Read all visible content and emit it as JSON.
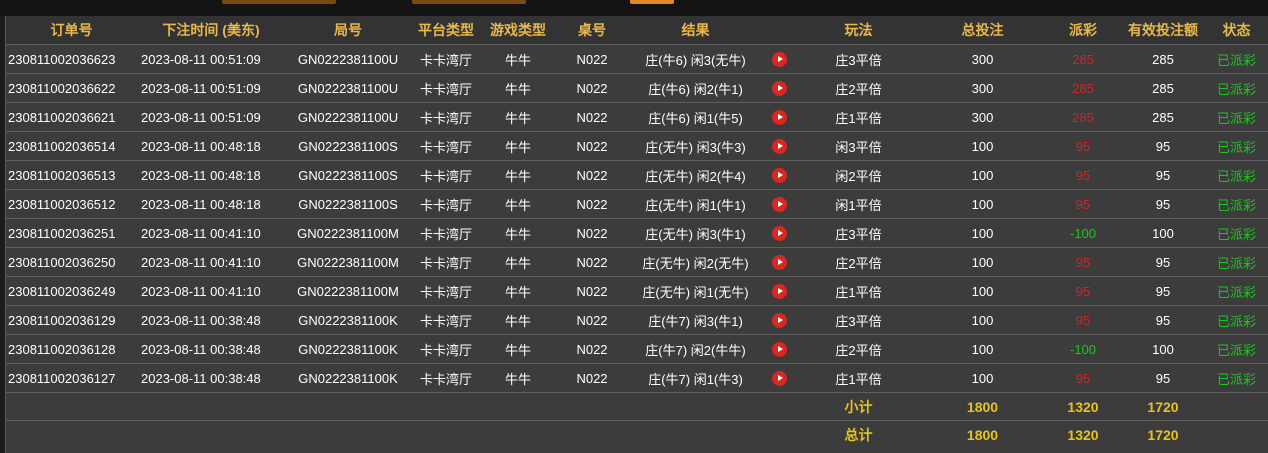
{
  "headers": [
    "订单号",
    "下注时间 (美东)",
    "局号",
    "平台类型",
    "游戏类型",
    "桌号",
    "结果",
    "",
    "玩法",
    "总投注",
    "派彩",
    "有效投注额",
    "状态"
  ],
  "rows": [
    {
      "order": "230811002036623",
      "time": "2023-08-11 00:51:09",
      "round": "GN0222381100U",
      "platform": "卡卡湾厅",
      "game": "牛牛",
      "table": "N022",
      "result": "庄(牛6) 闲3(无牛)",
      "play": "庄3平倍",
      "bet": "300",
      "payout": "285",
      "payout_color": "red",
      "valid": "285",
      "status": "已派彩"
    },
    {
      "order": "230811002036622",
      "time": "2023-08-11 00:51:09",
      "round": "GN0222381100U",
      "platform": "卡卡湾厅",
      "game": "牛牛",
      "table": "N022",
      "result": "庄(牛6) 闲2(牛1)",
      "play": "庄2平倍",
      "bet": "300",
      "payout": "285",
      "payout_color": "red",
      "valid": "285",
      "status": "已派彩"
    },
    {
      "order": "230811002036621",
      "time": "2023-08-11 00:51:09",
      "round": "GN0222381100U",
      "platform": "卡卡湾厅",
      "game": "牛牛",
      "table": "N022",
      "result": "庄(牛6) 闲1(牛5)",
      "play": "庄1平倍",
      "bet": "300",
      "payout": "285",
      "payout_color": "red",
      "valid": "285",
      "status": "已派彩"
    },
    {
      "order": "230811002036514",
      "time": "2023-08-11 00:48:18",
      "round": "GN0222381100S",
      "platform": "卡卡湾厅",
      "game": "牛牛",
      "table": "N022",
      "result": "庄(无牛) 闲3(牛3)",
      "play": "闲3平倍",
      "bet": "100",
      "payout": "95",
      "payout_color": "red",
      "valid": "95",
      "status": "已派彩"
    },
    {
      "order": "230811002036513",
      "time": "2023-08-11 00:48:18",
      "round": "GN0222381100S",
      "platform": "卡卡湾厅",
      "game": "牛牛",
      "table": "N022",
      "result": "庄(无牛) 闲2(牛4)",
      "play": "闲2平倍",
      "bet": "100",
      "payout": "95",
      "payout_color": "red",
      "valid": "95",
      "status": "已派彩"
    },
    {
      "order": "230811002036512",
      "time": "2023-08-11 00:48:18",
      "round": "GN0222381100S",
      "platform": "卡卡湾厅",
      "game": "牛牛",
      "table": "N022",
      "result": "庄(无牛) 闲1(牛1)",
      "play": "闲1平倍",
      "bet": "100",
      "payout": "95",
      "payout_color": "red",
      "valid": "95",
      "status": "已派彩"
    },
    {
      "order": "230811002036251",
      "time": "2023-08-11 00:41:10",
      "round": "GN0222381100M",
      "platform": "卡卡湾厅",
      "game": "牛牛",
      "table": "N022",
      "result": "庄(无牛) 闲3(牛1)",
      "play": "庄3平倍",
      "bet": "100",
      "payout": "-100",
      "payout_color": "green",
      "valid": "100",
      "status": "已派彩"
    },
    {
      "order": "230811002036250",
      "time": "2023-08-11 00:41:10",
      "round": "GN0222381100M",
      "platform": "卡卡湾厅",
      "game": "牛牛",
      "table": "N022",
      "result": "庄(无牛) 闲2(无牛)",
      "play": "庄2平倍",
      "bet": "100",
      "payout": "95",
      "payout_color": "red",
      "valid": "95",
      "status": "已派彩"
    },
    {
      "order": "230811002036249",
      "time": "2023-08-11 00:41:10",
      "round": "GN0222381100M",
      "platform": "卡卡湾厅",
      "game": "牛牛",
      "table": "N022",
      "result": "庄(无牛) 闲1(无牛)",
      "play": "庄1平倍",
      "bet": "100",
      "payout": "95",
      "payout_color": "red",
      "valid": "95",
      "status": "已派彩"
    },
    {
      "order": "230811002036129",
      "time": "2023-08-11 00:38:48",
      "round": "GN0222381100K",
      "platform": "卡卡湾厅",
      "game": "牛牛",
      "table": "N022",
      "result": "庄(牛7) 闲3(牛1)",
      "play": "庄3平倍",
      "bet": "100",
      "payout": "95",
      "payout_color": "red",
      "valid": "95",
      "status": "已派彩"
    },
    {
      "order": "230811002036128",
      "time": "2023-08-11 00:38:48",
      "round": "GN0222381100K",
      "platform": "卡卡湾厅",
      "game": "牛牛",
      "table": "N022",
      "result": "庄(牛7) 闲2(牛牛)",
      "play": "庄2平倍",
      "bet": "100",
      "payout": "-100",
      "payout_color": "green",
      "valid": "100",
      "status": "已派彩"
    },
    {
      "order": "230811002036127",
      "time": "2023-08-11 00:38:48",
      "round": "GN0222381100K",
      "platform": "卡卡湾厅",
      "game": "牛牛",
      "table": "N022",
      "result": "庄(牛7) 闲1(牛3)",
      "play": "庄1平倍",
      "bet": "100",
      "payout": "95",
      "payout_color": "red",
      "valid": "95",
      "status": "已派彩"
    }
  ],
  "subtotal": {
    "label": "小计",
    "bet": "1800",
    "payout": "1320",
    "valid": "1720"
  },
  "total": {
    "label": "总计",
    "bet": "1800",
    "payout": "1320",
    "valid": "1720"
  },
  "icons": {
    "replay": "play-icon"
  },
  "colors": {
    "header_text": "#e8b84a",
    "payout_red": "#c8282a",
    "payout_green": "#18c81c",
    "status_green": "#18c81c",
    "summary_text": "#e8c320"
  }
}
